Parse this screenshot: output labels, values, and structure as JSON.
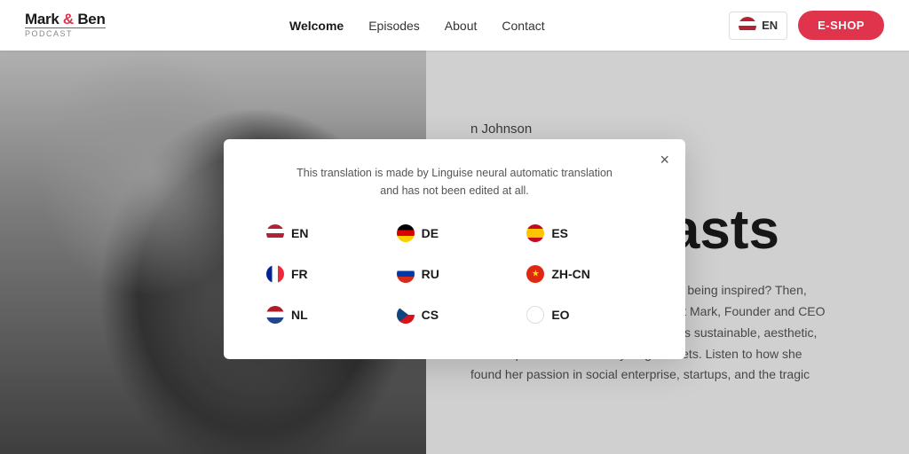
{
  "header": {
    "logo_main": "Mark & Ben",
    "logo_sub": "Podcast",
    "nav": [
      {
        "label": "Welcome",
        "active": true
      },
      {
        "label": "Episodes",
        "active": false
      },
      {
        "label": "About",
        "active": false
      },
      {
        "label": "Contact",
        "active": false
      }
    ],
    "lang_current": "EN",
    "eshop_label": "E-SHOP"
  },
  "hero": {
    "name": "n Johnson",
    "heading": "podcasts",
    "desc_html": "Interested in listening to <strong>podcasts</strong> and being inspired? Then, today's episode is perfect for you! Meet Mark, Founder and CEO of the company, a company that creates sustainable, aesthetic, and the perfect functional cycling helmets. Listen to how she found her passion in social enterprise, startups, and the tragic"
  },
  "modal": {
    "note": "This translation is made by Linguise neural automatic translation and has not been edited at all.",
    "close_label": "×",
    "languages": [
      {
        "code": "EN",
        "flag": "us"
      },
      {
        "code": "DE",
        "flag": "de"
      },
      {
        "code": "ES",
        "flag": "es"
      },
      {
        "code": "FR",
        "flag": "fr"
      },
      {
        "code": "RU",
        "flag": "ru"
      },
      {
        "code": "ZH-CN",
        "flag": "cn"
      },
      {
        "code": "NL",
        "flag": "nl"
      },
      {
        "code": "CS",
        "flag": "cs"
      },
      {
        "code": "EO",
        "flag": "eo"
      }
    ]
  }
}
